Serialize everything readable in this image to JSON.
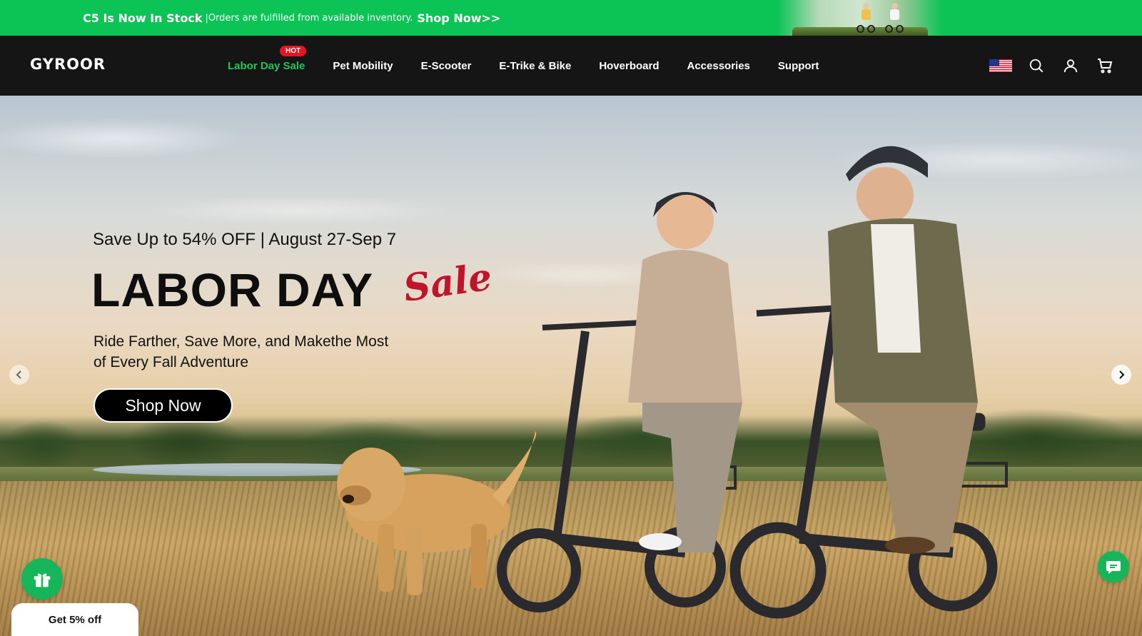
{
  "announcement": {
    "headline": "C5 Is Now In Stock",
    "message": "|Orders are fulfilled from available inventory.",
    "link_label": "Shop Now>>"
  },
  "header": {
    "logo_text": "GYROOR",
    "nav": [
      {
        "label": "Labor Day Sale",
        "badge": "HOT",
        "active": true
      },
      {
        "label": "Pet Mobility"
      },
      {
        "label": "E-Scooter"
      },
      {
        "label": "E-Trike & Bike"
      },
      {
        "label": "Hoverboard"
      },
      {
        "label": "Accessories"
      },
      {
        "label": "Support"
      }
    ],
    "icons": [
      "us-flag-icon",
      "search-icon",
      "account-icon",
      "cart-icon"
    ]
  },
  "hero": {
    "subtitle": "Save Up to 54% OFF | August 27-Sep 7",
    "title": "LABOR DAY",
    "title_script": "Sale",
    "description": "Ride Farther, Save More, and Makethe Most of Every Fall Adventure",
    "cta_label": "Shop Now"
  },
  "widgets": {
    "discount_label": "Get 5% off"
  },
  "colors": {
    "announce_bg": "#0cc356",
    "header_bg": "#151515",
    "active_nav": "#22c55e",
    "hot_badge": "#e8141f",
    "script_red": "#c0142a",
    "widget_green": "#17b559"
  }
}
